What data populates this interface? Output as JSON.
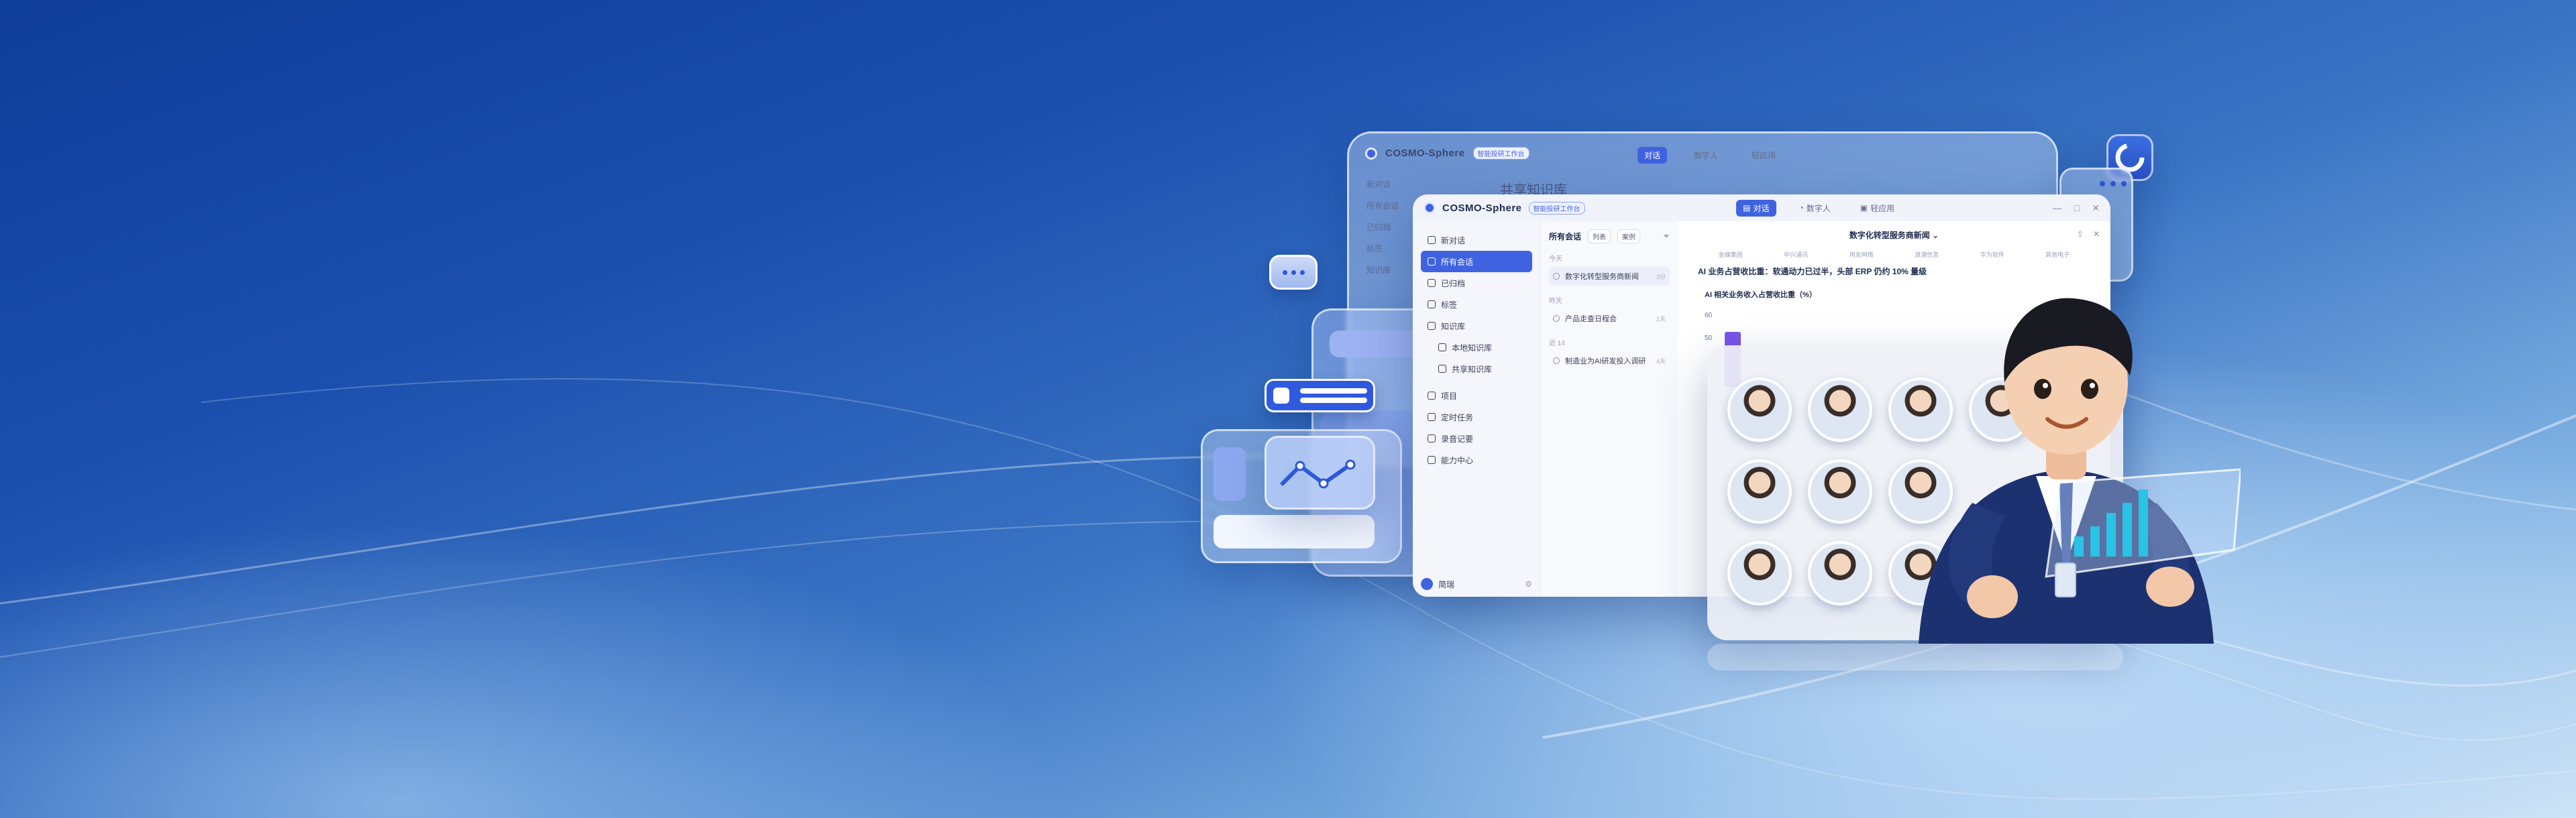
{
  "app": {
    "title": "COSMO-Sphere",
    "badge": "智能投研工作台",
    "tabs": [
      {
        "label": "对话",
        "active": true
      },
      {
        "label": "数字人",
        "active": false
      },
      {
        "label": "轻应用",
        "active": false
      }
    ],
    "window_controls": [
      "—",
      "□",
      "✕"
    ]
  },
  "back_window": {
    "title": "COSMO-Sphere",
    "badge": "智能投研工作台",
    "tabs": [
      "对话",
      "数字人",
      "轻应用"
    ],
    "heading": "共享知识库",
    "sidebar": [
      "新对话",
      "所有会话",
      "已归档",
      "标签",
      "知识库"
    ]
  },
  "sidebar": {
    "items": [
      {
        "label": "新对话",
        "icon": "new-chat-icon",
        "active": false
      },
      {
        "label": "所有会话",
        "icon": "chat-list-icon",
        "active": true
      },
      {
        "label": "已归档",
        "icon": "archive-icon",
        "active": false
      },
      {
        "label": "标签",
        "icon": "tag-icon",
        "active": false
      },
      {
        "label": "知识库",
        "icon": "book-icon",
        "active": false
      },
      {
        "label": "本地知识库",
        "icon": "folder-icon",
        "active": false,
        "sub": true
      },
      {
        "label": "共享知识库",
        "icon": "share-icon",
        "active": false,
        "sub": true
      },
      {
        "label": "项目",
        "icon": "project-icon",
        "active": false
      },
      {
        "label": "定时任务",
        "icon": "clock-icon",
        "active": false
      },
      {
        "label": "录音记要",
        "icon": "mic-icon",
        "active": false
      },
      {
        "label": "能力中心",
        "icon": "grid-icon",
        "active": false
      }
    ],
    "user": "简瑞"
  },
  "conversations": {
    "header": "所有会话",
    "filters": [
      "列表",
      "案例"
    ],
    "groups": [
      {
        "label": "今天",
        "items": [
          {
            "title": "数字化转型服务商新闻",
            "meta": "3分",
            "active": true
          }
        ]
      },
      {
        "label": "昨天",
        "items": [
          {
            "title": "产品走查日程会",
            "meta": "1天",
            "active": false
          }
        ]
      },
      {
        "label": "近 14",
        "items": [
          {
            "title": "制造业为AI研发投入调研",
            "meta": "4天",
            "active": false
          }
        ]
      }
    ]
  },
  "main": {
    "title": "数字化转型服务商新闻 ⌄",
    "subtabs": [
      "金蝶集团",
      "中兴通讯",
      "用友网络",
      "浪潮信息",
      "华为软件",
      "其他电子"
    ],
    "headline": "AI 业务占营收比重：软通动力已过半，头部 ERP 仍约 10% 量级",
    "chart_title": "AI 相关业务收入占营收比重（%）"
  },
  "chart_data": {
    "type": "bar",
    "title": "AI 相关业务收入占营收比重（%）",
    "yticks": [
      60,
      50
    ],
    "categories": [
      ""
    ],
    "values": [
      50
    ]
  },
  "colors": {
    "accent": "#3f63e0",
    "bar": "#7b55e8"
  }
}
